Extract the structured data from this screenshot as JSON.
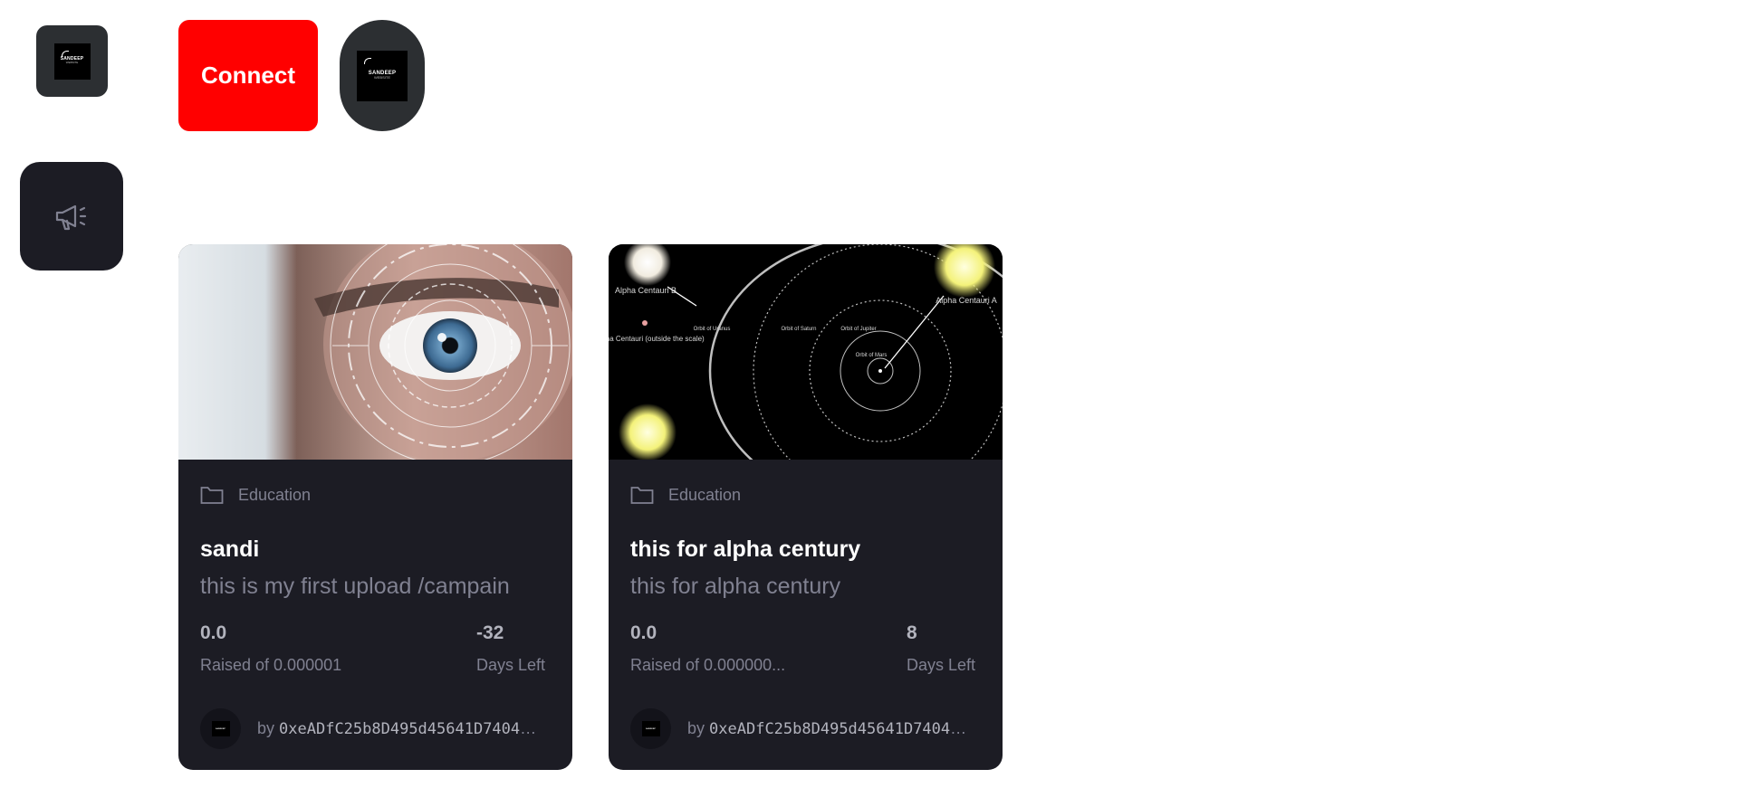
{
  "sidebar": {
    "logo_text": "SANDEEP",
    "logo_subtext": "WEBSITE",
    "nav_icon": "megaphone-icon"
  },
  "header": {
    "connect_label": "Connect",
    "profile_logo_text": "SANDEEP",
    "profile_logo_subtext": "WEBSITE"
  },
  "colors": {
    "accent": "#ff0000",
    "card_bg": "#1c1c24",
    "sidebar_tile": "#2c2f32",
    "muted_text": "#808191"
  },
  "campaigns": [
    {
      "image_icon": "eye-scan-image",
      "category": "Education",
      "title": "sandi",
      "description": "this is my first upload /campain",
      "raised": "0.0",
      "raised_label": "Raised of 0.000001",
      "days_left": "-32",
      "days_label": "Days Left",
      "owner_prefix": "by",
      "owner": "0xeADfC25b8D495d45641D7404E..."
    },
    {
      "image_icon": "solar-orbit-diagram-image",
      "image_labels": {
        "alpha_b": "Alpha Centauri B",
        "proxima": "Proxima Centauri (outside the scale)",
        "alpha_a": "Alpha Centauri A",
        "orbit_uranus": "Orbit of Uranus",
        "orbit_saturn": "Orbit of Saturn",
        "orbit_jupiter": "Orbit of Jupiter",
        "orbit_mars": "Orbit of Mars"
      },
      "category": "Education",
      "title": "this for alpha century",
      "description": "this for alpha century",
      "raised": "0.0",
      "raised_label": "Raised of 0.000000...",
      "days_left": "8",
      "days_label": "Days Left",
      "owner_prefix": "by",
      "owner": "0xeADfC25b8D495d45641D7404E..."
    }
  ]
}
